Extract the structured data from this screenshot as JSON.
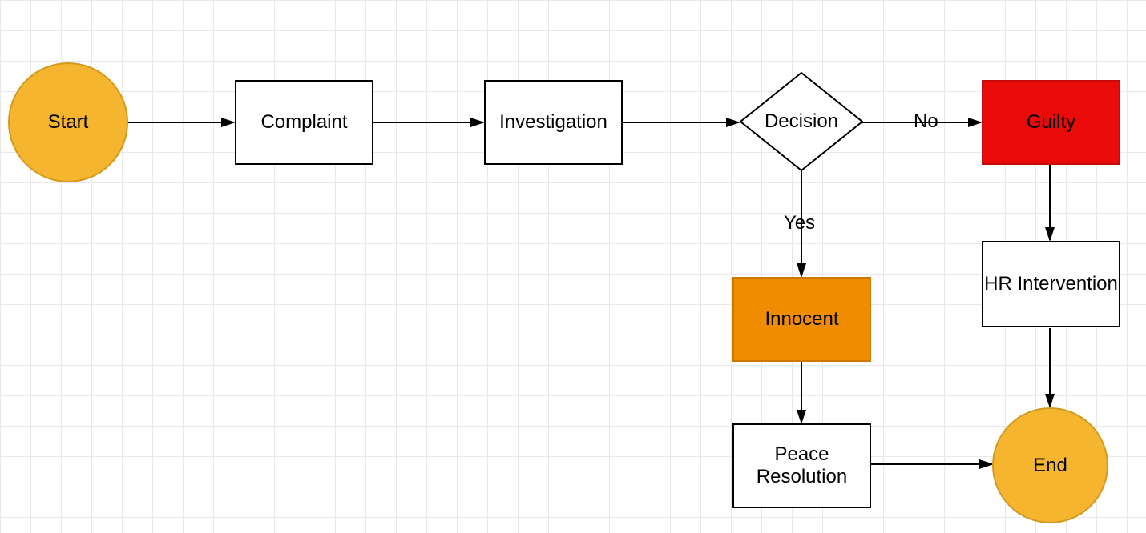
{
  "nodes": {
    "start": {
      "label": "Start"
    },
    "complaint": {
      "label": "Complaint"
    },
    "investigation": {
      "label": "Investigation"
    },
    "decision": {
      "label": "Decision"
    },
    "guilty": {
      "label": "Guilty"
    },
    "innocent": {
      "label": "Innocent"
    },
    "hr": {
      "label": "HR Intervention"
    },
    "peace": {
      "label": "Peace Resolution"
    },
    "end": {
      "label": "End"
    }
  },
  "edges": {
    "decision_no": {
      "label": "No"
    },
    "decision_yes": {
      "label": "Yes"
    }
  },
  "colors": {
    "terminal": "#f5b52e",
    "guilty": "#ea0a0a",
    "innocent": "#f08c00"
  }
}
